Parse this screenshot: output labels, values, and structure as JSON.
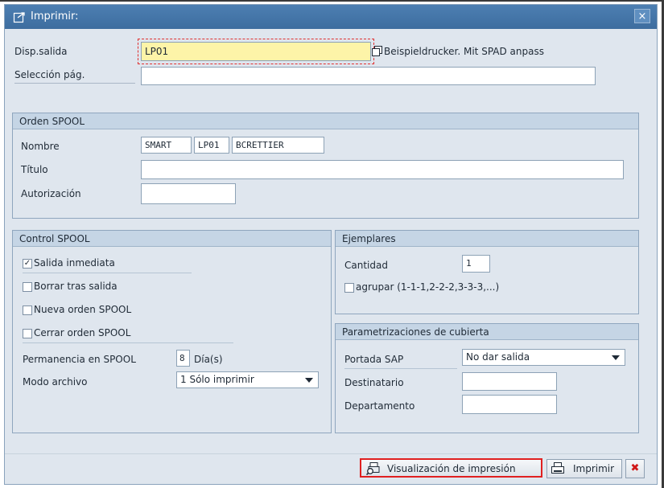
{
  "window": {
    "title": "Imprimir:",
    "close_glyph": "×"
  },
  "output": {
    "device_label": "Disp.salida",
    "device_value": "LP01",
    "device_desc": "Beispieldrucker. Mit SPAD anpass",
    "pages_label": "Selección pág.",
    "pages_value": ""
  },
  "spool_request": {
    "header": "Orden SPOOL",
    "name_label": "Nombre",
    "name_parts": [
      "SMART",
      "LP01",
      "BCRETTIER"
    ],
    "title_label": "Título",
    "title_value": "",
    "auth_label": "Autorización",
    "auth_value": ""
  },
  "spool_control": {
    "header": "Control SPOOL",
    "options": [
      {
        "label": "Salida inmediata",
        "checked": true
      },
      {
        "label": "Borrar tras salida",
        "checked": false
      },
      {
        "label": "Nueva orden SPOOL",
        "checked": false
      },
      {
        "label": "Cerrar orden SPOOL",
        "checked": false
      }
    ],
    "retention_label": "Permanencia en SPOOL",
    "retention_value": "8",
    "retention_unit": "Día(s)",
    "archive_label": "Modo archivo",
    "archive_value": "1 Sólo imprimir"
  },
  "copies": {
    "header": "Ejemplares",
    "qty_label": "Cantidad",
    "qty_value": "1",
    "group_label": "agrupar (1-1-1,2-2-2,3-3-3,...)",
    "group_checked": false
  },
  "cover": {
    "header": "Parametrizaciones de cubierta",
    "sap_cover_label": "Portada SAP",
    "sap_cover_value": "No dar salida",
    "recipient_label": "Destinatario",
    "recipient_value": "",
    "department_label": "Departamento",
    "department_value": ""
  },
  "footer": {
    "preview_label": "Visualización de impresión",
    "print_label": "Imprimir",
    "cancel_glyph": "✖"
  },
  "colors": {
    "titlebar": "#3d6d9f",
    "highlight": "#e02020",
    "focus_field": "#fdf4a8",
    "cancel": "#d01818"
  },
  "icons": [
    "print-dialog-icon",
    "close-icon",
    "device-lookup-icon",
    "checkbox-icon",
    "dropdown-arrow-icon",
    "print-preview-icon",
    "printer-icon",
    "cancel-icon"
  ]
}
